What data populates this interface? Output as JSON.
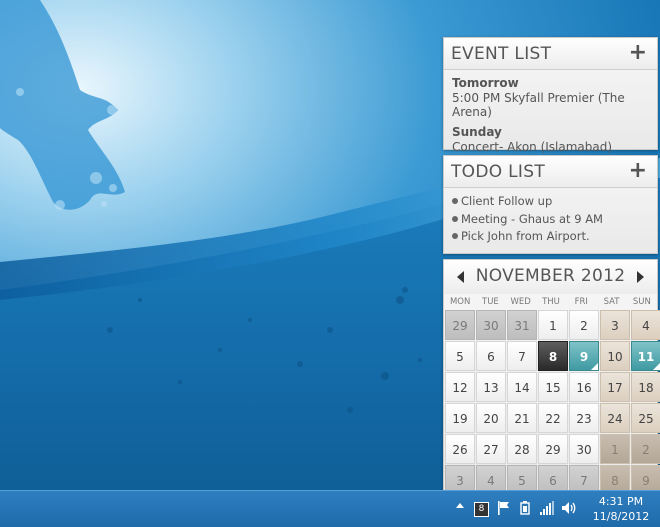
{
  "colors": {
    "taskbar": "#2f7fc0",
    "wallpaper_blue": "#1679b8",
    "event_day": "#3f9aa2",
    "today": "#2a2a2a",
    "weekend": "#dccfbf"
  },
  "event_list": {
    "title": "EVENT LIST",
    "add_icon": "+",
    "groups": [
      {
        "day": "Tomorrow",
        "item": "5:00 PM Skyfall Premier (The Arena)"
      },
      {
        "day": "Sunday",
        "item": "Concert- Akon (Islamabad)"
      }
    ]
  },
  "todo_list": {
    "title": "TODO LIST",
    "add_icon": "+",
    "items": [
      "Client Follow up",
      "Meeting - Ghaus at 9 AM",
      "Pick John from Airport."
    ]
  },
  "calendar": {
    "title": "NOVEMBER 2012",
    "days_of_week": [
      "MON",
      "TUE",
      "WED",
      "THU",
      "FRI",
      "SAT",
      "SUN"
    ],
    "weeks": [
      [
        {
          "d": "29",
          "s": "other"
        },
        {
          "d": "30",
          "s": "other"
        },
        {
          "d": "31",
          "s": "other"
        },
        {
          "d": "1"
        },
        {
          "d": "2"
        },
        {
          "d": "3",
          "s": "weekend"
        },
        {
          "d": "4",
          "s": "weekend"
        }
      ],
      [
        {
          "d": "5"
        },
        {
          "d": "6"
        },
        {
          "d": "7"
        },
        {
          "d": "8",
          "s": "today"
        },
        {
          "d": "9",
          "s": "event"
        },
        {
          "d": "10",
          "s": "weekend"
        },
        {
          "d": "11",
          "s": "event"
        }
      ],
      [
        {
          "d": "12"
        },
        {
          "d": "13"
        },
        {
          "d": "14"
        },
        {
          "d": "15"
        },
        {
          "d": "16"
        },
        {
          "d": "17",
          "s": "weekend"
        },
        {
          "d": "18",
          "s": "weekend"
        }
      ],
      [
        {
          "d": "19"
        },
        {
          "d": "20"
        },
        {
          "d": "21"
        },
        {
          "d": "22"
        },
        {
          "d": "23"
        },
        {
          "d": "24",
          "s": "weekend"
        },
        {
          "d": "25",
          "s": "weekend"
        }
      ],
      [
        {
          "d": "26"
        },
        {
          "d": "27"
        },
        {
          "d": "28"
        },
        {
          "d": "29"
        },
        {
          "d": "30"
        },
        {
          "d": "1",
          "s": "weekend other"
        },
        {
          "d": "2",
          "s": "weekend other"
        }
      ],
      [
        {
          "d": "3",
          "s": "other"
        },
        {
          "d": "4",
          "s": "other"
        },
        {
          "d": "5",
          "s": "other"
        },
        {
          "d": "6",
          "s": "other"
        },
        {
          "d": "7",
          "s": "other"
        },
        {
          "d": "8",
          "s": "weekend other"
        },
        {
          "d": "9",
          "s": "weekend other"
        }
      ]
    ]
  },
  "taskbar": {
    "badge": "8",
    "icons": [
      "show-hidden-icons-icon",
      "action-center-flag-icon",
      "power-icon",
      "network-signal-icon",
      "volume-icon"
    ],
    "time": "4:31 PM",
    "date": "11/8/2012"
  }
}
